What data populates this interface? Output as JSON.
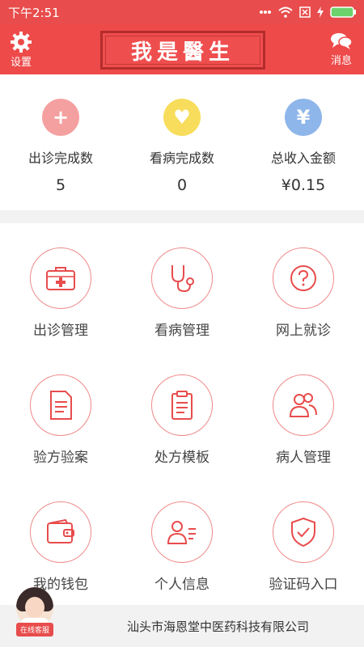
{
  "status_bar": {
    "time": "下午2:51"
  },
  "header": {
    "settings_label": "设置",
    "title": "我是醫生",
    "messages_label": "消息"
  },
  "stats": [
    {
      "label": "出诊完成数",
      "value": "5",
      "icon": "plus-icon",
      "color": "#f5a0a0",
      "glyph": "+"
    },
    {
      "label": "看病完成数",
      "value": "0",
      "icon": "heart-icon",
      "color": "#f7dd5b",
      "glyph": "♥"
    },
    {
      "label": "总收入金额",
      "value": "¥0.15",
      "icon": "yen-icon",
      "color": "#8eb6ea",
      "glyph": "¥"
    }
  ],
  "menu": [
    {
      "label": "出诊管理",
      "icon": "medical-kit-icon"
    },
    {
      "label": "看病管理",
      "icon": "stethoscope-icon"
    },
    {
      "label": "网上就诊",
      "icon": "question-icon"
    },
    {
      "label": "验方验案",
      "icon": "document-icon"
    },
    {
      "label": "处方模板",
      "icon": "clipboard-icon"
    },
    {
      "label": "病人管理",
      "icon": "users-icon"
    },
    {
      "label": "我的钱包",
      "icon": "wallet-icon"
    },
    {
      "label": "个人信息",
      "icon": "profile-card-icon"
    },
    {
      "label": "验证码入口",
      "icon": "shield-check-icon"
    }
  ],
  "service": {
    "label": "在线客服"
  },
  "footer": {
    "company": "汕头市海恩堂中医药科技有限公司"
  },
  "colors": {
    "brand": "#ee4a4a",
    "icon_outline": "#ef8a8a"
  }
}
